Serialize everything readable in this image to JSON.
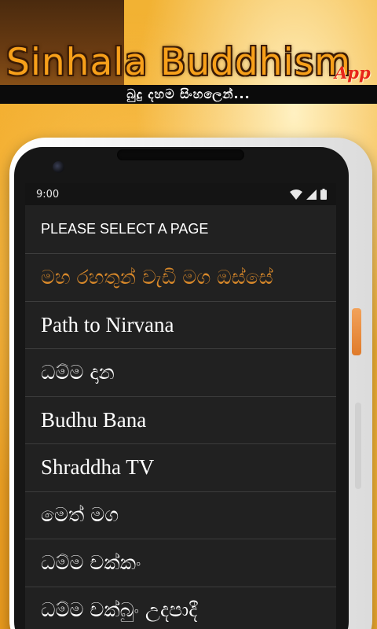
{
  "banner": {
    "title": "Sinhala Buddhism",
    "app_tag": "App",
    "subtitle": "බුදු දහම සිංහලෙන්..."
  },
  "status_bar": {
    "time": "9:00",
    "icons": [
      "wifi-icon",
      "signal-icon",
      "battery-icon"
    ]
  },
  "header": {
    "title": "PLEASE SELECT A PAGE"
  },
  "pages": [
    {
      "label": "මහ රහතුන් වැඩි මග ඔස්සේ",
      "selected": true
    },
    {
      "label": "Path to Nirvana"
    },
    {
      "label": "ධම්ම දාන"
    },
    {
      "label": "Budhu Bana"
    },
    {
      "label": "Shraddha TV"
    },
    {
      "label": "මෙත් මග"
    },
    {
      "label": "ධම්ම චක්කං"
    },
    {
      "label": "ධම්ම චක්බුං උදපාදී"
    }
  ],
  "colors": {
    "accent": "#d9892a",
    "title_orange": "#f7a01a",
    "app_tag_red": "#e8261a",
    "screen_bg": "#212121"
  }
}
